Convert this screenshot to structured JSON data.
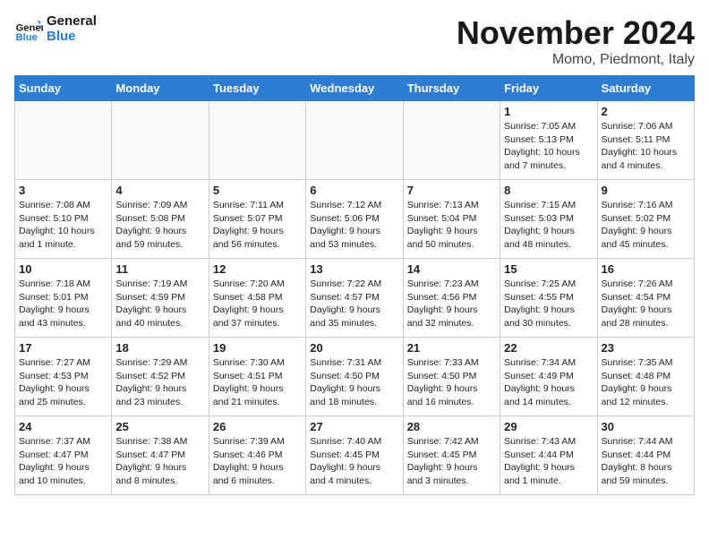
{
  "header": {
    "logo_general": "General",
    "logo_blue": "Blue",
    "month_title": "November 2024",
    "location": "Momo, Piedmont, Italy"
  },
  "days_of_week": [
    "Sunday",
    "Monday",
    "Tuesday",
    "Wednesday",
    "Thursday",
    "Friday",
    "Saturday"
  ],
  "weeks": [
    [
      {
        "day": "",
        "info": "",
        "empty": true
      },
      {
        "day": "",
        "info": "",
        "empty": true
      },
      {
        "day": "",
        "info": "",
        "empty": true
      },
      {
        "day": "",
        "info": "",
        "empty": true
      },
      {
        "day": "",
        "info": "",
        "empty": true
      },
      {
        "day": "1",
        "info": "Sunrise: 7:05 AM\nSunset: 5:13 PM\nDaylight: 10 hours\nand 7 minutes."
      },
      {
        "day": "2",
        "info": "Sunrise: 7:06 AM\nSunset: 5:11 PM\nDaylight: 10 hours\nand 4 minutes."
      }
    ],
    [
      {
        "day": "3",
        "info": "Sunrise: 7:08 AM\nSunset: 5:10 PM\nDaylight: 10 hours\nand 1 minute."
      },
      {
        "day": "4",
        "info": "Sunrise: 7:09 AM\nSunset: 5:08 PM\nDaylight: 9 hours\nand 59 minutes."
      },
      {
        "day": "5",
        "info": "Sunrise: 7:11 AM\nSunset: 5:07 PM\nDaylight: 9 hours\nand 56 minutes."
      },
      {
        "day": "6",
        "info": "Sunrise: 7:12 AM\nSunset: 5:06 PM\nDaylight: 9 hours\nand 53 minutes."
      },
      {
        "day": "7",
        "info": "Sunrise: 7:13 AM\nSunset: 5:04 PM\nDaylight: 9 hours\nand 50 minutes."
      },
      {
        "day": "8",
        "info": "Sunrise: 7:15 AM\nSunset: 5:03 PM\nDaylight: 9 hours\nand 48 minutes."
      },
      {
        "day": "9",
        "info": "Sunrise: 7:16 AM\nSunset: 5:02 PM\nDaylight: 9 hours\nand 45 minutes."
      }
    ],
    [
      {
        "day": "10",
        "info": "Sunrise: 7:18 AM\nSunset: 5:01 PM\nDaylight: 9 hours\nand 43 minutes."
      },
      {
        "day": "11",
        "info": "Sunrise: 7:19 AM\nSunset: 4:59 PM\nDaylight: 9 hours\nand 40 minutes."
      },
      {
        "day": "12",
        "info": "Sunrise: 7:20 AM\nSunset: 4:58 PM\nDaylight: 9 hours\nand 37 minutes."
      },
      {
        "day": "13",
        "info": "Sunrise: 7:22 AM\nSunset: 4:57 PM\nDaylight: 9 hours\nand 35 minutes."
      },
      {
        "day": "14",
        "info": "Sunrise: 7:23 AM\nSunset: 4:56 PM\nDaylight: 9 hours\nand 32 minutes."
      },
      {
        "day": "15",
        "info": "Sunrise: 7:25 AM\nSunset: 4:55 PM\nDaylight: 9 hours\nand 30 minutes."
      },
      {
        "day": "16",
        "info": "Sunrise: 7:26 AM\nSunset: 4:54 PM\nDaylight: 9 hours\nand 28 minutes."
      }
    ],
    [
      {
        "day": "17",
        "info": "Sunrise: 7:27 AM\nSunset: 4:53 PM\nDaylight: 9 hours\nand 25 minutes."
      },
      {
        "day": "18",
        "info": "Sunrise: 7:29 AM\nSunset: 4:52 PM\nDaylight: 9 hours\nand 23 minutes."
      },
      {
        "day": "19",
        "info": "Sunrise: 7:30 AM\nSunset: 4:51 PM\nDaylight: 9 hours\nand 21 minutes."
      },
      {
        "day": "20",
        "info": "Sunrise: 7:31 AM\nSunset: 4:50 PM\nDaylight: 9 hours\nand 18 minutes."
      },
      {
        "day": "21",
        "info": "Sunrise: 7:33 AM\nSunset: 4:50 PM\nDaylight: 9 hours\nand 16 minutes."
      },
      {
        "day": "22",
        "info": "Sunrise: 7:34 AM\nSunset: 4:49 PM\nDaylight: 9 hours\nand 14 minutes."
      },
      {
        "day": "23",
        "info": "Sunrise: 7:35 AM\nSunset: 4:48 PM\nDaylight: 9 hours\nand 12 minutes."
      }
    ],
    [
      {
        "day": "24",
        "info": "Sunrise: 7:37 AM\nSunset: 4:47 PM\nDaylight: 9 hours\nand 10 minutes."
      },
      {
        "day": "25",
        "info": "Sunrise: 7:38 AM\nSunset: 4:47 PM\nDaylight: 9 hours\nand 8 minutes."
      },
      {
        "day": "26",
        "info": "Sunrise: 7:39 AM\nSunset: 4:46 PM\nDaylight: 9 hours\nand 6 minutes."
      },
      {
        "day": "27",
        "info": "Sunrise: 7:40 AM\nSunset: 4:45 PM\nDaylight: 9 hours\nand 4 minutes."
      },
      {
        "day": "28",
        "info": "Sunrise: 7:42 AM\nSunset: 4:45 PM\nDaylight: 9 hours\nand 3 minutes."
      },
      {
        "day": "29",
        "info": "Sunrise: 7:43 AM\nSunset: 4:44 PM\nDaylight: 9 hours\nand 1 minute."
      },
      {
        "day": "30",
        "info": "Sunrise: 7:44 AM\nSunset: 4:44 PM\nDaylight: 8 hours\nand 59 minutes."
      }
    ]
  ]
}
